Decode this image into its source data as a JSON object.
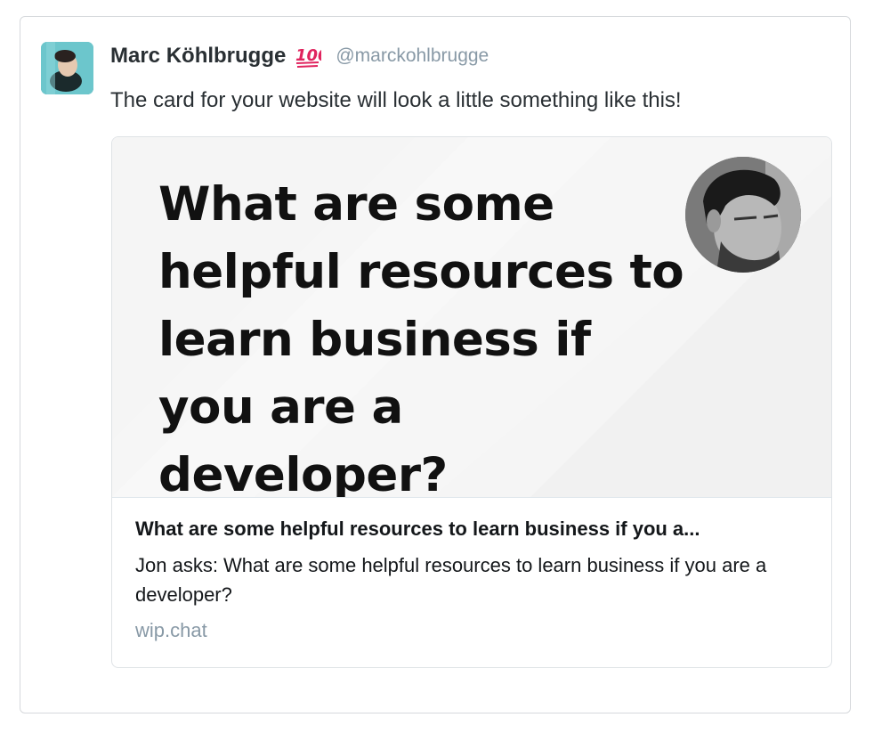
{
  "tweet": {
    "author": {
      "name": "Marc Köhlbrugge",
      "emoji": "hundred-points-emoji",
      "handle": "@marckohlbrugge"
    },
    "text": "The card for your website will look a little something like this!"
  },
  "card": {
    "image_headline": "What are some helpful resources to learn business if you are a developer?",
    "title": "What are some helpful resources to learn business if you a...",
    "description": "Jon asks: What are some helpful resources to learn business if you are a developer?",
    "domain": "wip.chat"
  },
  "colors": {
    "name": "#292f33",
    "handle": "#8899a6",
    "emoji_red": "#e0245e",
    "domain": "#8899a6",
    "border": "#d6d9dc"
  }
}
